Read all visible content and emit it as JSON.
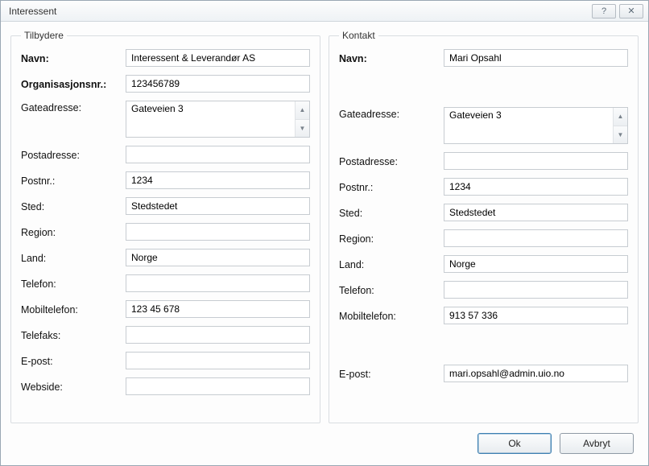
{
  "window": {
    "title": "Interessent",
    "help_glyph": "?",
    "close_glyph": "✕"
  },
  "groups": {
    "providers": {
      "legend": "Tilbydere"
    },
    "contact": {
      "legend": "Kontakt"
    }
  },
  "labels": {
    "name": "Navn:",
    "orgno": "Organisasjonsnr.:",
    "street": "Gateadresse:",
    "postaddr": "Postadresse:",
    "postno": "Postnr.:",
    "place": "Sted:",
    "region": "Region:",
    "country": "Land:",
    "phone": "Telefon:",
    "mobile": "Mobiltelefon:",
    "fax": "Telefaks:",
    "email": "E-post:",
    "website": "Webside:"
  },
  "provider": {
    "name": "Interessent & Leverandør AS",
    "orgno": "123456789",
    "street": "Gateveien 3",
    "postaddr": "",
    "postno": "1234",
    "place": "Stedstedet",
    "region": "",
    "country": "Norge",
    "phone": "",
    "mobile": "123 45 678",
    "fax": "",
    "email": "",
    "website": ""
  },
  "contact": {
    "name": "Mari Opsahl",
    "street": "Gateveien 3",
    "postaddr": "",
    "postno": "1234",
    "place": "Stedstedet",
    "region": "",
    "country": "Norge",
    "phone": "",
    "mobile": "913 57 336",
    "email": "mari.opsahl@admin.uio.no"
  },
  "buttons": {
    "ok": "Ok",
    "cancel": "Avbryt"
  }
}
